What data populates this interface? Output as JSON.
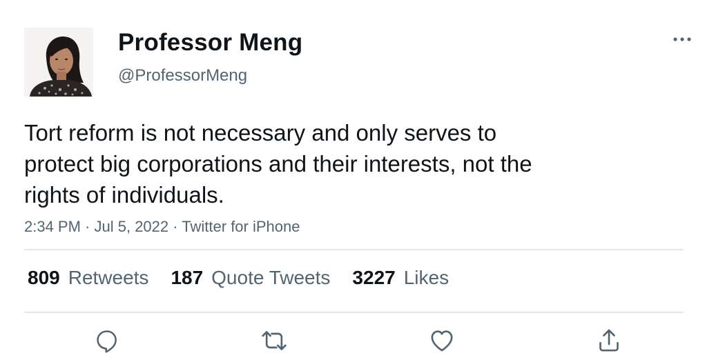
{
  "user": {
    "display_name": "Professor Meng",
    "handle": "@ProfessorMeng",
    "avatar": "profile-photo"
  },
  "tweet": {
    "text": "Tort reform is not necessary and only serves to\nprotect big corporations and their interests, not the\nrights of individuals.",
    "time": "2:34 PM",
    "separator": " · ",
    "date": "Jul 5, 2022",
    "source": "Twitter for iPhone"
  },
  "stats": {
    "retweets": {
      "count": "809",
      "label": "Retweets"
    },
    "quote_tweets": {
      "count": "187",
      "label": "Quote Tweets"
    },
    "likes": {
      "count": "3227",
      "label": "Likes"
    }
  },
  "icons": {
    "more": "more-options-icon",
    "reply": "reply-icon",
    "retweet": "retweet-icon",
    "like": "heart-icon",
    "share": "share-icon"
  },
  "colors": {
    "text_primary": "#0f1419",
    "text_secondary": "#536471",
    "divider": "#e4e8eb"
  }
}
